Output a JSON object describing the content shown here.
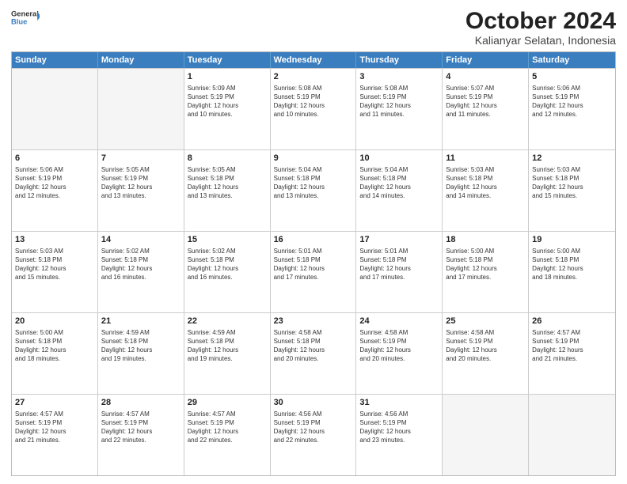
{
  "header": {
    "logo_line1": "General",
    "logo_line2": "Blue",
    "title": "October 2024",
    "subtitle": "Kalianyar Selatan, Indonesia"
  },
  "weekdays": [
    "Sunday",
    "Monday",
    "Tuesday",
    "Wednesday",
    "Thursday",
    "Friday",
    "Saturday"
  ],
  "weeks": [
    [
      {
        "day": "",
        "info": "",
        "empty": true
      },
      {
        "day": "",
        "info": "",
        "empty": true
      },
      {
        "day": "1",
        "info": "Sunrise: 5:09 AM\nSunset: 5:19 PM\nDaylight: 12 hours\nand 10 minutes.",
        "empty": false
      },
      {
        "day": "2",
        "info": "Sunrise: 5:08 AM\nSunset: 5:19 PM\nDaylight: 12 hours\nand 10 minutes.",
        "empty": false
      },
      {
        "day": "3",
        "info": "Sunrise: 5:08 AM\nSunset: 5:19 PM\nDaylight: 12 hours\nand 11 minutes.",
        "empty": false
      },
      {
        "day": "4",
        "info": "Sunrise: 5:07 AM\nSunset: 5:19 PM\nDaylight: 12 hours\nand 11 minutes.",
        "empty": false
      },
      {
        "day": "5",
        "info": "Sunrise: 5:06 AM\nSunset: 5:19 PM\nDaylight: 12 hours\nand 12 minutes.",
        "empty": false
      }
    ],
    [
      {
        "day": "6",
        "info": "Sunrise: 5:06 AM\nSunset: 5:19 PM\nDaylight: 12 hours\nand 12 minutes.",
        "empty": false
      },
      {
        "day": "7",
        "info": "Sunrise: 5:05 AM\nSunset: 5:19 PM\nDaylight: 12 hours\nand 13 minutes.",
        "empty": false
      },
      {
        "day": "8",
        "info": "Sunrise: 5:05 AM\nSunset: 5:18 PM\nDaylight: 12 hours\nand 13 minutes.",
        "empty": false
      },
      {
        "day": "9",
        "info": "Sunrise: 5:04 AM\nSunset: 5:18 PM\nDaylight: 12 hours\nand 13 minutes.",
        "empty": false
      },
      {
        "day": "10",
        "info": "Sunrise: 5:04 AM\nSunset: 5:18 PM\nDaylight: 12 hours\nand 14 minutes.",
        "empty": false
      },
      {
        "day": "11",
        "info": "Sunrise: 5:03 AM\nSunset: 5:18 PM\nDaylight: 12 hours\nand 14 minutes.",
        "empty": false
      },
      {
        "day": "12",
        "info": "Sunrise: 5:03 AM\nSunset: 5:18 PM\nDaylight: 12 hours\nand 15 minutes.",
        "empty": false
      }
    ],
    [
      {
        "day": "13",
        "info": "Sunrise: 5:03 AM\nSunset: 5:18 PM\nDaylight: 12 hours\nand 15 minutes.",
        "empty": false
      },
      {
        "day": "14",
        "info": "Sunrise: 5:02 AM\nSunset: 5:18 PM\nDaylight: 12 hours\nand 16 minutes.",
        "empty": false
      },
      {
        "day": "15",
        "info": "Sunrise: 5:02 AM\nSunset: 5:18 PM\nDaylight: 12 hours\nand 16 minutes.",
        "empty": false
      },
      {
        "day": "16",
        "info": "Sunrise: 5:01 AM\nSunset: 5:18 PM\nDaylight: 12 hours\nand 17 minutes.",
        "empty": false
      },
      {
        "day": "17",
        "info": "Sunrise: 5:01 AM\nSunset: 5:18 PM\nDaylight: 12 hours\nand 17 minutes.",
        "empty": false
      },
      {
        "day": "18",
        "info": "Sunrise: 5:00 AM\nSunset: 5:18 PM\nDaylight: 12 hours\nand 17 minutes.",
        "empty": false
      },
      {
        "day": "19",
        "info": "Sunrise: 5:00 AM\nSunset: 5:18 PM\nDaylight: 12 hours\nand 18 minutes.",
        "empty": false
      }
    ],
    [
      {
        "day": "20",
        "info": "Sunrise: 5:00 AM\nSunset: 5:18 PM\nDaylight: 12 hours\nand 18 minutes.",
        "empty": false
      },
      {
        "day": "21",
        "info": "Sunrise: 4:59 AM\nSunset: 5:18 PM\nDaylight: 12 hours\nand 19 minutes.",
        "empty": false
      },
      {
        "day": "22",
        "info": "Sunrise: 4:59 AM\nSunset: 5:18 PM\nDaylight: 12 hours\nand 19 minutes.",
        "empty": false
      },
      {
        "day": "23",
        "info": "Sunrise: 4:58 AM\nSunset: 5:18 PM\nDaylight: 12 hours\nand 20 minutes.",
        "empty": false
      },
      {
        "day": "24",
        "info": "Sunrise: 4:58 AM\nSunset: 5:19 PM\nDaylight: 12 hours\nand 20 minutes.",
        "empty": false
      },
      {
        "day": "25",
        "info": "Sunrise: 4:58 AM\nSunset: 5:19 PM\nDaylight: 12 hours\nand 20 minutes.",
        "empty": false
      },
      {
        "day": "26",
        "info": "Sunrise: 4:57 AM\nSunset: 5:19 PM\nDaylight: 12 hours\nand 21 minutes.",
        "empty": false
      }
    ],
    [
      {
        "day": "27",
        "info": "Sunrise: 4:57 AM\nSunset: 5:19 PM\nDaylight: 12 hours\nand 21 minutes.",
        "empty": false
      },
      {
        "day": "28",
        "info": "Sunrise: 4:57 AM\nSunset: 5:19 PM\nDaylight: 12 hours\nand 22 minutes.",
        "empty": false
      },
      {
        "day": "29",
        "info": "Sunrise: 4:57 AM\nSunset: 5:19 PM\nDaylight: 12 hours\nand 22 minutes.",
        "empty": false
      },
      {
        "day": "30",
        "info": "Sunrise: 4:56 AM\nSunset: 5:19 PM\nDaylight: 12 hours\nand 22 minutes.",
        "empty": false
      },
      {
        "day": "31",
        "info": "Sunrise: 4:56 AM\nSunset: 5:19 PM\nDaylight: 12 hours\nand 23 minutes.",
        "empty": false
      },
      {
        "day": "",
        "info": "",
        "empty": true
      },
      {
        "day": "",
        "info": "",
        "empty": true
      }
    ]
  ]
}
